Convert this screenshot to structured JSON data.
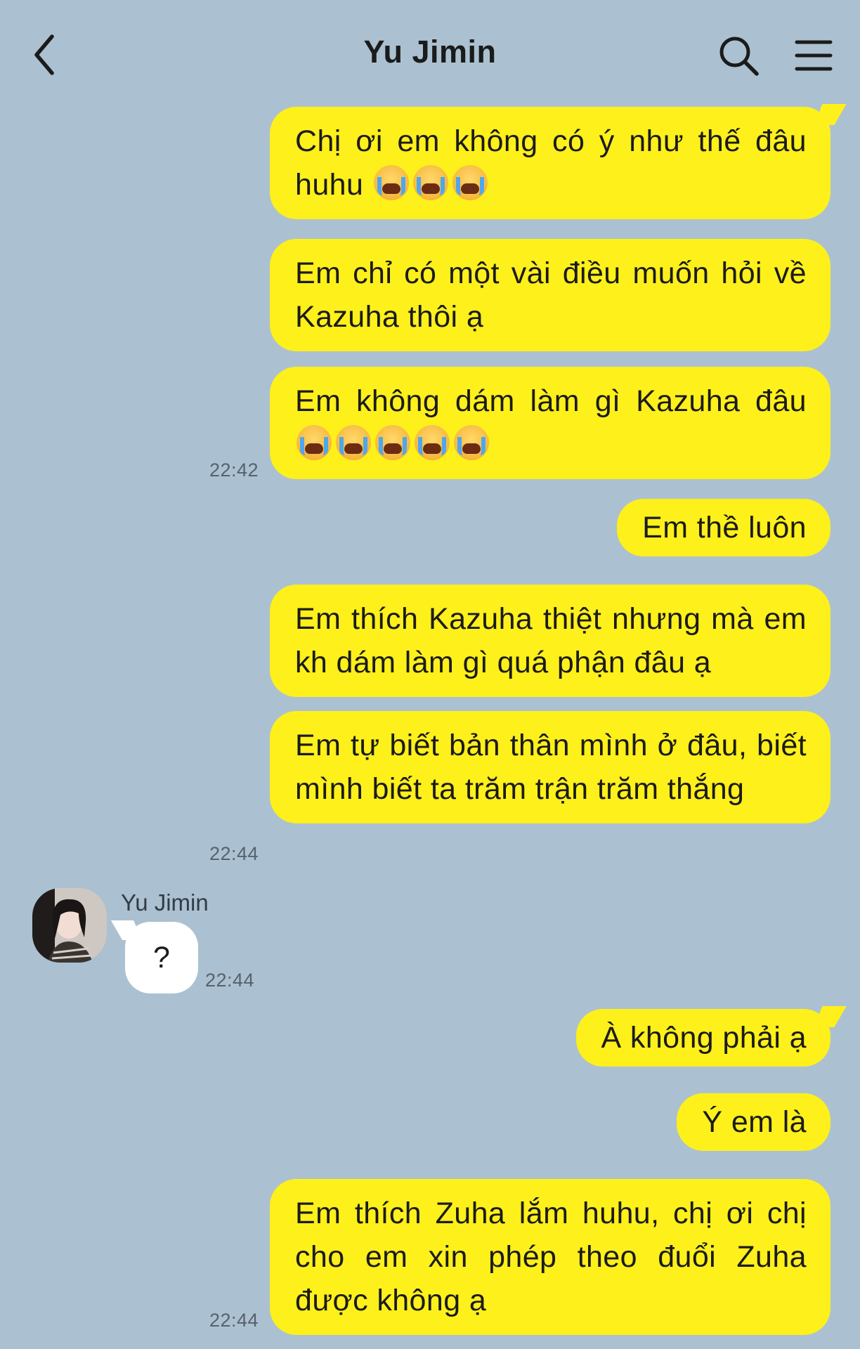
{
  "header": {
    "title": "Yu Jimin",
    "back_icon": "chevron-left-icon",
    "search_icon": "search-icon",
    "menu_icon": "hamburger-menu-icon"
  },
  "colors": {
    "background": "#abc1d1",
    "outgoing_bubble": "#fef01b",
    "incoming_bubble": "#ffffff"
  },
  "messages": [
    {
      "dir": "out",
      "text": "Chị ơi em không có ý như thế đâu huhu",
      "emoji": "loudly-crying-face",
      "emoji_count": 3,
      "time": ""
    },
    {
      "dir": "out",
      "text": "Em chỉ có một vài điều muốn hỏi về Kazuha thôi ạ",
      "time": ""
    },
    {
      "dir": "out",
      "text": "Em không dám làm gì Kazuha đâu",
      "emoji": "loudly-crying-face",
      "emoji_count": 5,
      "time": "22:42"
    },
    {
      "dir": "out",
      "text": "Em thề luôn",
      "time": ""
    },
    {
      "dir": "out",
      "text": "Em thích Kazuha thiệt nhưng mà em kh dám làm gì quá phận đâu ạ",
      "time": ""
    },
    {
      "dir": "out",
      "text": "Em tự biết bản thân mình ở đâu, biết mình biết ta trăm trận trăm thắng",
      "time": "22:44"
    },
    {
      "dir": "in",
      "sender": "Yu Jimin",
      "text": "?",
      "time": "22:44"
    },
    {
      "dir": "out",
      "text": "À không phải ạ",
      "time": ""
    },
    {
      "dir": "out",
      "text": "Ý em là",
      "time": ""
    },
    {
      "dir": "out",
      "text": "Em thích Zuha lắm huhu, chị ơi chị cho em xin phép theo đuổi Zuha được không ạ",
      "time": "22:44"
    }
  ]
}
